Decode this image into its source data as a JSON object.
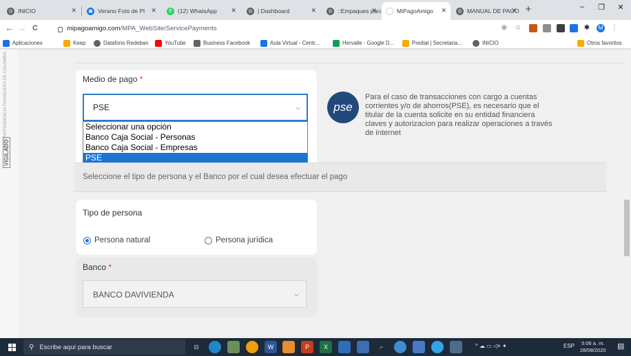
{
  "browser": {
    "tabs": [
      {
        "title": "INICIO",
        "icon": "globe-icon",
        "color": "#5f6368"
      },
      {
        "title": "Verano Foto de Pl",
        "icon": "photo-icon",
        "color": "#1a73e8"
      },
      {
        "title": "(12) WhatsApp",
        "icon": "whatsapp-icon",
        "color": "#25d366"
      },
      {
        "title": "| Dashboard",
        "icon": "globe-icon",
        "color": "#5f6368"
      },
      {
        "title": "::Empaques para",
        "icon": "globe-icon",
        "color": "#5f6368"
      },
      {
        "title": "MiPagoAmigo",
        "icon": "loading-icon",
        "color": "#9aa0a6"
      },
      {
        "title": "MANUAL DE PAGO",
        "icon": "globe-icon",
        "color": "#5f6368"
      }
    ],
    "new_tab": "+",
    "window_controls": {
      "minimize": "–",
      "maximize": "❐",
      "close": "✕"
    },
    "nav": {
      "back": "←",
      "forward": "→",
      "reload": "C"
    },
    "url_host": "mipagoamigo.com",
    "url_path": "/MPA_WebSite/ServicePayments",
    "bookmarks": [
      {
        "label": "Aplicaciones",
        "color": "#1a73e8"
      },
      {
        "label": "Keep",
        "color": "#f9ab00"
      },
      {
        "label": "Datafono Redeban",
        "color": "#5f6368"
      },
      {
        "label": "YouTube",
        "color": "#ff0000"
      },
      {
        "label": "Business Facebook",
        "color": "#5f6368"
      },
      {
        "label": "Aula Virtual - Centr...",
        "color": "#1a73e8"
      },
      {
        "label": "Hervalle - Google D...",
        "color": "#0f9d58"
      },
      {
        "label": "Predial | Secretaria...",
        "color": "#f9ab00"
      },
      {
        "label": "INICIO",
        "color": "#5f6368"
      }
    ],
    "other_bookmarks": "Otros favoritos"
  },
  "sidebar": {
    "vertical_text": "SUPERINTENDENCIA FINANCIERA DE COLOMBIA",
    "logo_text": "VIGILADO"
  },
  "payment": {
    "label": "Medio de pago",
    "required_mark": "*",
    "selected": "PSE",
    "options": [
      "Seleccionar una opción",
      "Banco Caja Social - Personas",
      "Banco Caja Social - Empresas",
      "PSE"
    ],
    "pse_logo": "pse",
    "pse_description": "Para el caso de transacciones con cargo a cuentas corrientes y/o de ahorros(PSE), es necesario que el titular de la cuenta solicite en su entidad financiera claves y autorizacion para realizar operaciones a través de internet"
  },
  "instructions": "Seleccione el tipo de persona y el Banco por el cual desea efectuar el pago",
  "person_type": {
    "label": "Tipo de persona",
    "options": [
      {
        "label": "Persona natural",
        "checked": true
      },
      {
        "label": "Persona jurídica",
        "checked": false
      }
    ]
  },
  "bank": {
    "label": "Banco",
    "required_mark": "*",
    "selected": "BANCO DAVIVIENDA"
  },
  "taskbar": {
    "search_placeholder": "Escribe aquí para buscar",
    "language": "ESP",
    "time": "5:06 a. m.",
    "date": "28/08/2020"
  }
}
